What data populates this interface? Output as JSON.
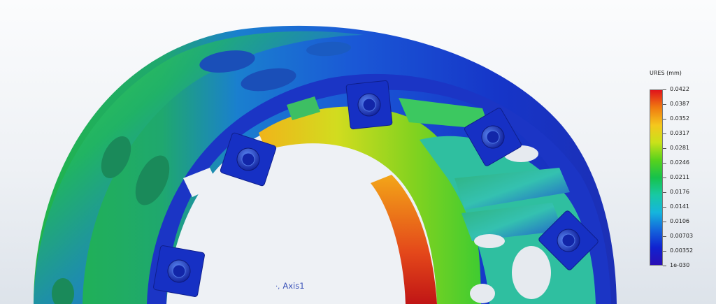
{
  "legend": {
    "title": "URES (mm)",
    "ticks": [
      "0.0422",
      "0.0387",
      "0.0352",
      "0.0317",
      "0.0281",
      "0.0246",
      "0.0211",
      "0.0176",
      "0.0141",
      "0.0106",
      "0.00703",
      "0.00352",
      "1e-030"
    ],
    "gradient_colors": [
      "#e0141b",
      "#f07a10",
      "#f5c71d",
      "#c9e21a",
      "#58d21c",
      "#16c24b",
      "#18c9a4",
      "#15b5dd",
      "#1466dc",
      "#1022d0",
      "#2a0fb5"
    ]
  },
  "axis": {
    "label": "Axis1",
    "glyph": "·,"
  }
}
